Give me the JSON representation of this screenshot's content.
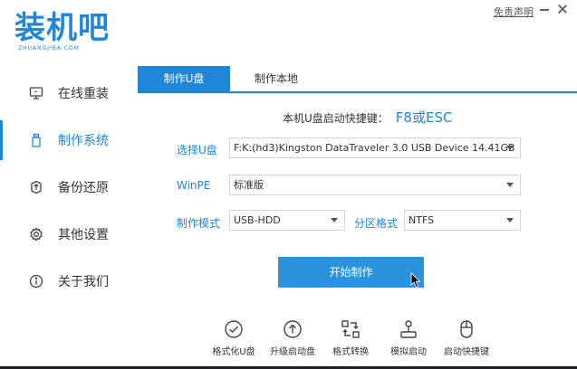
{
  "app": {
    "logo_text": "装机吧",
    "logo_subtext": "ZHUANGJIBA.COM",
    "disclaimer": "免责声明"
  },
  "sidebar": {
    "items": [
      {
        "label": "在线重装",
        "icon": "monitor-icon",
        "active": false
      },
      {
        "label": "制作系统",
        "icon": "usb-icon",
        "active": true
      },
      {
        "label": "备份还原",
        "icon": "backup-icon",
        "active": false
      },
      {
        "label": "其他设置",
        "icon": "gear-icon",
        "active": false
      },
      {
        "label": "关于我们",
        "icon": "info-icon",
        "active": false
      }
    ]
  },
  "tabs": [
    {
      "label": "制作U盘",
      "active": true
    },
    {
      "label": "制作本地",
      "active": false
    }
  ],
  "form": {
    "shortcut_label": "本机U盘启动快捷键：",
    "shortcut_key": "F8或ESC",
    "usb_label": "选择U盘",
    "usb_value": "F:K:(hd3)Kingston DataTraveler 3.0 USB Device 14.41GB",
    "winpe_label": "WinPE",
    "winpe_value": "标准版",
    "mode_label": "制作模式",
    "mode_value": "USB-HDD",
    "partition_label": "分区格式",
    "partition_value": "NTFS",
    "start_button": "开始制作"
  },
  "tools": [
    {
      "label": "格式化U盘",
      "icon": "check-circle-icon"
    },
    {
      "label": "升级启动盘",
      "icon": "upload-circle-icon"
    },
    {
      "label": "格式转换",
      "icon": "convert-icon"
    },
    {
      "label": "模拟启动",
      "icon": "joystick-icon"
    },
    {
      "label": "启动快捷键",
      "icon": "mouse-icon"
    }
  ],
  "colors": {
    "accent": "#1f86d8",
    "button": "#2b93dc"
  }
}
